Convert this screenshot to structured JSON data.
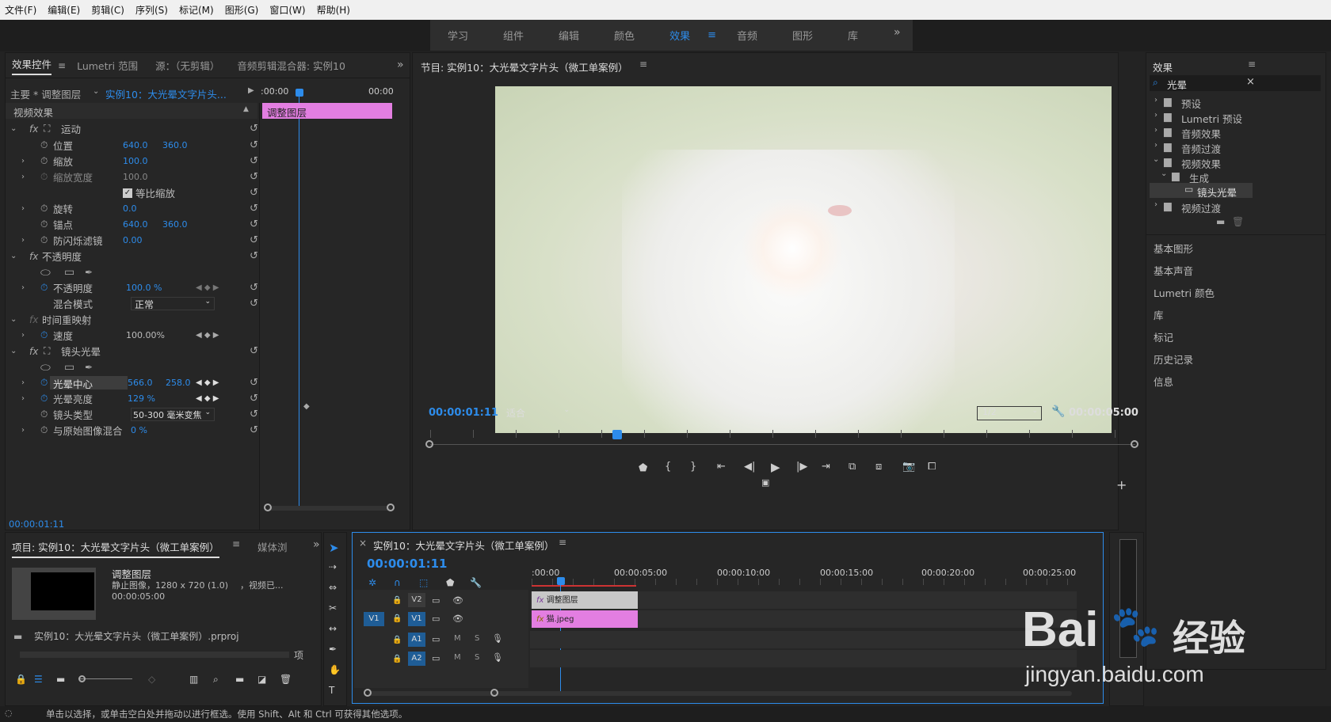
{
  "menu": [
    "文件(F)",
    "编辑(E)",
    "剪辑(C)",
    "序列(S)",
    "标记(M)",
    "图形(G)",
    "窗口(W)",
    "帮助(H)"
  ],
  "workspaces": [
    "学习",
    "组件",
    "编辑",
    "颜色",
    "效果",
    "音频",
    "图形",
    "库"
  ],
  "workspace_active": "效果",
  "ec": {
    "tabs": [
      "效果控件",
      "Lumetri 范围",
      "源：（无剪辑）",
      "音频剪辑混合器: 实例10"
    ],
    "master": "主要 * 调整图层",
    "seq": "实例10：大光晕文字片头...",
    "tc_start": ":00:00",
    "tc_end": "00:00",
    "clip_label": "调整图层",
    "section": "视频效果",
    "motion": "运动",
    "position": "位置",
    "pos_x": "640.0",
    "pos_y": "360.0",
    "scale": "缩放",
    "scale_v": "100.0",
    "scale_w": "缩放宽度",
    "scale_w_v": "100.0",
    "uniform": "等比缩放",
    "rotation": "旋转",
    "rot_v": "0.0",
    "anchor": "锚点",
    "anc_x": "640.0",
    "anc_y": "360.0",
    "flicker": "防闪烁滤镜",
    "flick_v": "0.00",
    "opacity_fx": "不透明度",
    "opacity": "不透明度",
    "opacity_v": "100.0 %",
    "blend": "混合模式",
    "blend_v": "正常",
    "timeremap": "时间重映射",
    "speed": "速度",
    "speed_v": "100.00%",
    "lens": "镜头光晕",
    "flare_center": "光晕中心",
    "fc_x": "566.0",
    "fc_y": "258.0",
    "flare_bright": "光晕亮度",
    "fb_v": "129 %",
    "lens_type": "镜头类型",
    "lens_type_v": "50-300 毫米变焦",
    "blend_orig": "与原始图像混合",
    "bo_v": "0 %",
    "timecode": "00:00:01:11"
  },
  "program": {
    "title": "节目: 实例10：大光晕文字片头（微工单案例）",
    "tc": "00:00:01:11",
    "fit": "适合",
    "res": "1/2",
    "duration": "00:00:05:00"
  },
  "effects": {
    "title": "效果",
    "search": "光晕",
    "items": [
      "预设",
      "Lumetri 预设",
      "音频效果",
      "音频过渡",
      "视频效果",
      "生成",
      "镜头光晕",
      "视频过渡"
    ],
    "links": [
      "基本图形",
      "基本声音",
      "Lumetri 颜色",
      "库",
      "标记",
      "历史记录",
      "信息"
    ]
  },
  "project": {
    "tabs": [
      "项目: 实例10：大光晕文字片头（微工单案例）",
      "媒体浏"
    ],
    "item_name": "调整图层",
    "item_type": "静止图像，1280 x 720 (1.0)",
    "item_extra": "，视频已...",
    "item_dur": "00:00:05:00",
    "file": "实例10：大光晕文字片头（微工单案例）.prproj",
    "count": "项"
  },
  "timeline": {
    "title": "实例10：大光晕文字片头（微工单案例）",
    "tc": "00:00:01:11",
    "ruler": [
      ":00:00",
      "00:00:05:00",
      "00:00:10:00",
      "00:00:15:00",
      "00:00:20:00",
      "00:00:25:00"
    ],
    "tracks": [
      "V2",
      "V1",
      "A1",
      "A2"
    ],
    "src_v": "V1",
    "clip_v2": "调整图层",
    "clip_v1": "猫.jpeg",
    "m": "M",
    "s": "S"
  },
  "status": "单击以选择，或单击空白处并拖动以进行框选。使用 Shift、Alt 和 Ctrl 可获得其他选项。",
  "watermark": {
    "brand": "Bai",
    "brand2": "经验",
    "url": "jingyan.baidu.com"
  },
  "colors": {
    "accent": "#2d8ceb",
    "clip_pink": "#e37ee1",
    "clip_gray": "#c8c8c8"
  }
}
